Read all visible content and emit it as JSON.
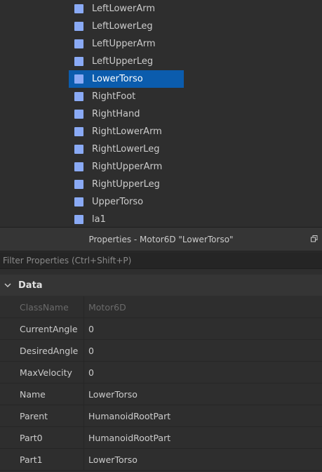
{
  "explorer": {
    "items": [
      {
        "label": "LeftLowerArm",
        "icon": "part-icon"
      },
      {
        "label": "LeftLowerLeg",
        "icon": "part-icon"
      },
      {
        "label": "LeftUpperArm",
        "icon": "part-icon"
      },
      {
        "label": "LeftUpperLeg",
        "icon": "part-icon"
      },
      {
        "label": "LowerTorso",
        "icon": "part-icon",
        "selected": true
      },
      {
        "label": "RightFoot",
        "icon": "part-icon"
      },
      {
        "label": "RightHand",
        "icon": "part-icon"
      },
      {
        "label": "RightLowerArm",
        "icon": "part-icon"
      },
      {
        "label": "RightLowerLeg",
        "icon": "part-icon"
      },
      {
        "label": "RightUpperArm",
        "icon": "part-icon"
      },
      {
        "label": "RightUpperLeg",
        "icon": "part-icon"
      },
      {
        "label": "UpperTorso",
        "icon": "part-icon"
      },
      {
        "label": "la1",
        "icon": "part-icon"
      }
    ],
    "selection_color": "#0b5cad",
    "icon_color": "#8aaaf5"
  },
  "properties": {
    "title": "Properties - Motor6D \"LowerTorso\"",
    "filter_placeholder": "Filter Properties (Ctrl+Shift+P)",
    "section_label": "Data",
    "rows": [
      {
        "name": "ClassName",
        "value": "Motor6D",
        "disabled": true
      },
      {
        "name": "CurrentAngle",
        "value": "0"
      },
      {
        "name": "DesiredAngle",
        "value": "0"
      },
      {
        "name": "MaxVelocity",
        "value": "0"
      },
      {
        "name": "Name",
        "value": "LowerTorso"
      },
      {
        "name": "Parent",
        "value": "HumanoidRootPart"
      },
      {
        "name": "Part0",
        "value": "HumanoidRootPart"
      },
      {
        "name": "Part1",
        "value": "LowerTorso"
      }
    ]
  }
}
